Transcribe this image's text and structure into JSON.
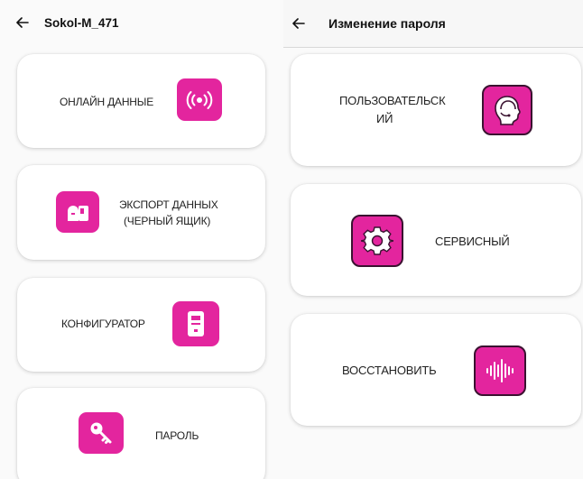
{
  "left": {
    "title": "Sokol-M_471",
    "cards": [
      {
        "label": "ОНЛАЙН ДАННЫЕ",
        "icon": "broadcast-icon"
      },
      {
        "label_line1": "ЭКСПОРТ ДАННЫХ",
        "label_line2": "(ЧЕРНЫЙ ЯЩИК)",
        "icon": "mailbox-icon"
      },
      {
        "label": "КОНФИГУРАТОР",
        "icon": "device-icon"
      },
      {
        "label": "ПАРОЛЬ",
        "icon": "key-icon"
      }
    ]
  },
  "right": {
    "title": "Изменение пароля",
    "cards": [
      {
        "label_line1": "ПОЛЬЗОВАТЕЛЬСК",
        "label_line2": "ИЙ",
        "icon": "user-headset-icon"
      },
      {
        "label": "СЕРВИСНЫЙ",
        "icon": "gear-icon"
      },
      {
        "label": "ВОССТАНОВИТЬ",
        "icon": "waveform-icon"
      }
    ]
  },
  "colors": {
    "accent": "#e3259e",
    "background": "#fafafa",
    "card": "#ffffff"
  }
}
